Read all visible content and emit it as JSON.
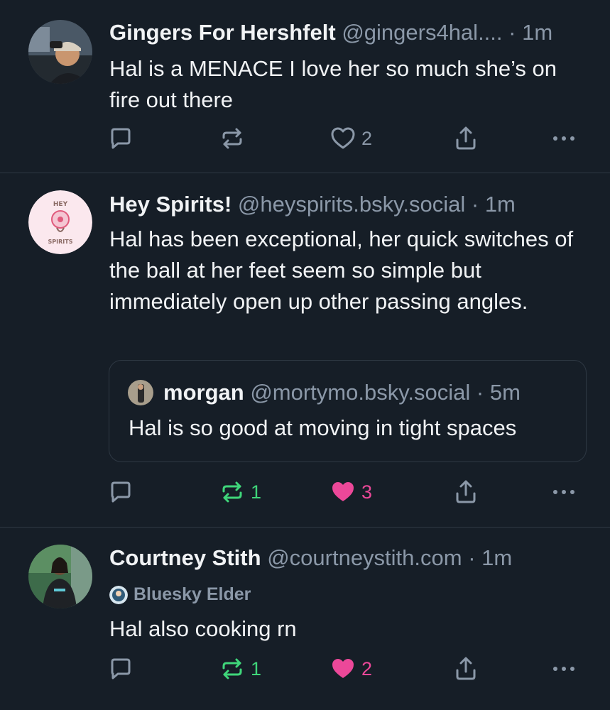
{
  "posts": [
    {
      "author_name": "Gingers For Hershfelt",
      "handle": "@gingers4hal....",
      "separator": "·",
      "time": "1m",
      "text": "Hal is a MENACE I love her so much she’s on fire out there",
      "reply_count": "",
      "repost_count": "",
      "like_count": "2",
      "liked": false,
      "reposted": false
    },
    {
      "author_name": "Hey Spirits!",
      "handle": "@heyspirits.bsky.social",
      "separator": "·",
      "time": "1m",
      "text": "Hal has been exceptional, her quick switches of the ball at her feet seem so simple but immediately open up other passing angles.",
      "avatar_text_top": "HEY",
      "avatar_text_bottom": "SPIRITS",
      "quote": {
        "author_name": "morgan",
        "handle": "@mortymo.bsky.social",
        "separator": "·",
        "time": "5m",
        "text": "Hal is so good at moving in tight spaces"
      },
      "reply_count": "",
      "repost_count": "1",
      "like_count": "3",
      "liked": true,
      "reposted": true
    },
    {
      "author_name": "Courtney Stith",
      "handle": "@courtneystith.com",
      "separator": "·",
      "time": "1m",
      "badge": "Bluesky Elder",
      "text": "Hal also cooking rn",
      "reply_count": "",
      "repost_count": "1",
      "like_count": "2",
      "liked": true,
      "reposted": true
    }
  ],
  "colors": {
    "background": "#161e27",
    "divider": "#2e3843",
    "muted": "#8b98a8",
    "repost_active": "#3fd67a",
    "like_active": "#ec4899"
  },
  "icons": {
    "reply": "reply-icon",
    "repost": "repost-icon",
    "like": "heart-icon",
    "share": "share-icon",
    "more": "more-icon"
  }
}
